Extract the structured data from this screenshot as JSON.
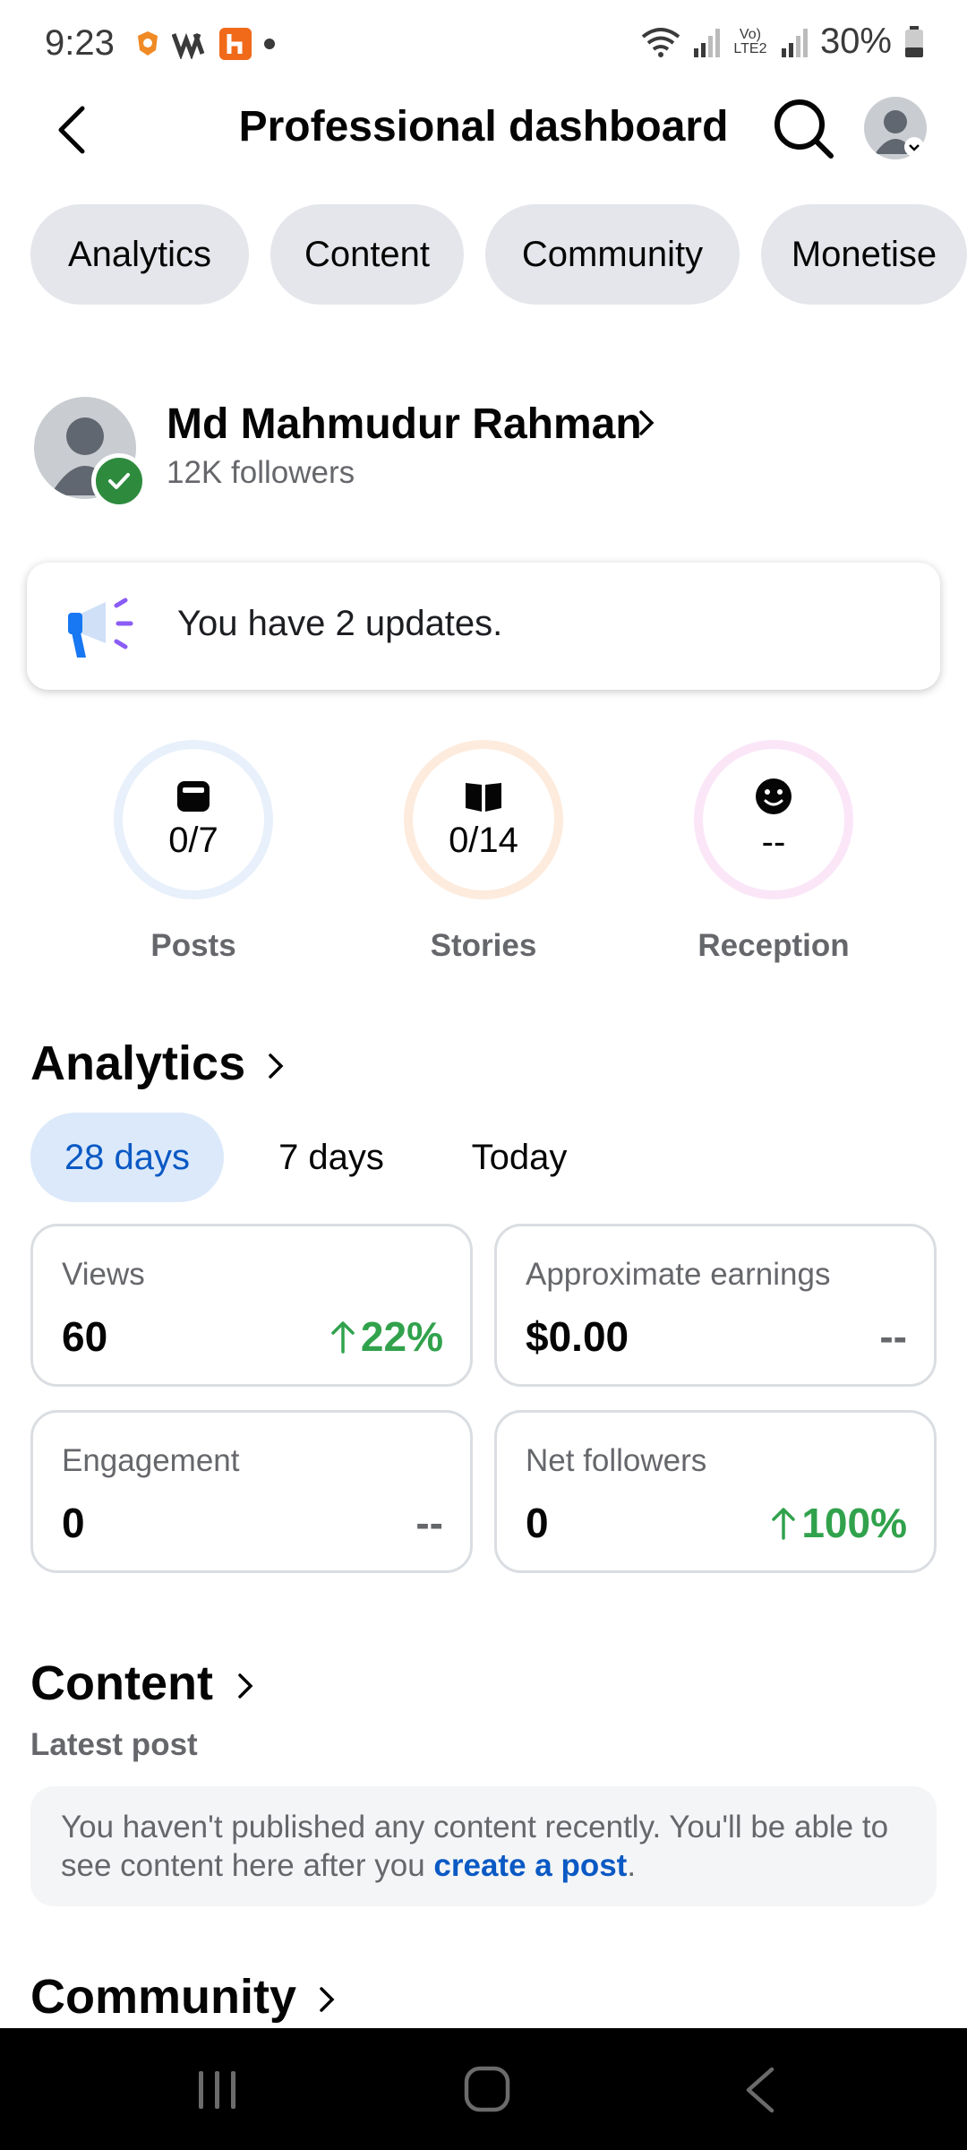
{
  "status_bar": {
    "time": "9:23",
    "battery": "30%",
    "network_label": "Vo) LTE2"
  },
  "header": {
    "title": "Professional dashboard"
  },
  "tabs": [
    {
      "label": "Analytics"
    },
    {
      "label": "Content"
    },
    {
      "label": "Community"
    },
    {
      "label": "Monetise"
    }
  ],
  "profile": {
    "name": "Md Mahmudur Rahman",
    "followers": "12K followers"
  },
  "updates": {
    "text": "You have 2 updates."
  },
  "stats": [
    {
      "value": "0/7",
      "label": "Posts",
      "icon": "posts-icon",
      "ring_color": "#e7f0fb"
    },
    {
      "value": "0/14",
      "label": "Stories",
      "icon": "book-icon",
      "ring_color": "#fdebdd"
    },
    {
      "value": "--",
      "label": "Reception",
      "icon": "smiley-icon",
      "ring_color": "#fbe6f8"
    }
  ],
  "analytics": {
    "title": "Analytics",
    "ranges": [
      {
        "label": "28 days",
        "selected": true
      },
      {
        "label": "7 days",
        "selected": false
      },
      {
        "label": "Today",
        "selected": false
      }
    ],
    "metrics": [
      {
        "label": "Views",
        "value": "60",
        "change": "22%",
        "trend": "up"
      },
      {
        "label": "Approximate earnings",
        "value": "$0.00",
        "change": "--",
        "trend": "none"
      },
      {
        "label": "Engagement",
        "value": "0",
        "change": "--",
        "trend": "none"
      },
      {
        "label": "Net followers",
        "value": "0",
        "change": "100%",
        "trend": "up"
      }
    ]
  },
  "content": {
    "title": "Content",
    "latest_label": "Latest post",
    "empty_text": "You haven't published any content recently. You'll be able to see content here after you ",
    "empty_link": "create a post",
    "empty_end": "."
  },
  "community": {
    "title": "Community"
  },
  "colors": {
    "accent_blue": "#0a59c4",
    "selected_bg": "#dbe9fa",
    "positive_green": "#31a24c",
    "verified_green": "#2e8b3e"
  }
}
